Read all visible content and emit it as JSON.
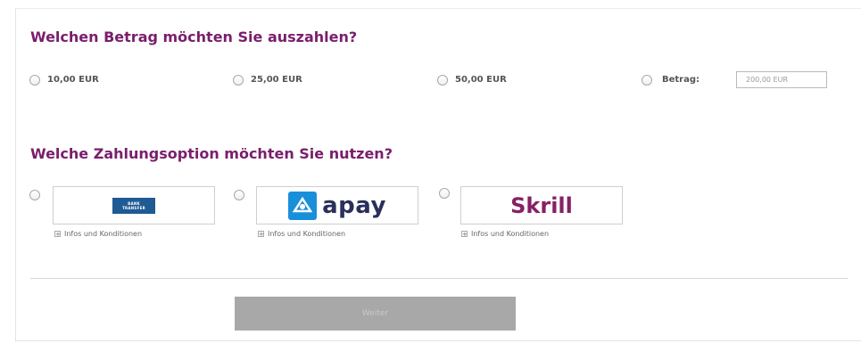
{
  "amount_section": {
    "title": "Welchen Betrag möchten Sie auszahlen?",
    "options": [
      {
        "label": "10,00 EUR"
      },
      {
        "label": "25,00 EUR"
      },
      {
        "label": "50,00 EUR"
      },
      {
        "label": "Betrag:"
      }
    ],
    "custom_amount_value": "200,00 EUR"
  },
  "payment_section": {
    "title": "Welche Zahlungsoption möchten Sie nutzen?",
    "methods": [
      {
        "logo_lines": [
          "BANK",
          "TRANSFER"
        ],
        "info_label": "Infos und Konditionen"
      },
      {
        "logo_text": "apay",
        "info_label": "Infos und Konditionen"
      },
      {
        "logo_text": "Skrill",
        "info_label": "Infos und Konditionen"
      }
    ],
    "info_toggle_symbol": "+"
  },
  "submit_button": {
    "label": "Weiter"
  },
  "colors": {
    "heading": "#7a1e6c",
    "button": "#a8a8a8",
    "skrill": "#862165",
    "apay_text": "#2a2f5c",
    "apay_mark": "#1a8fd9",
    "bank_logo": "#1f5a94"
  }
}
